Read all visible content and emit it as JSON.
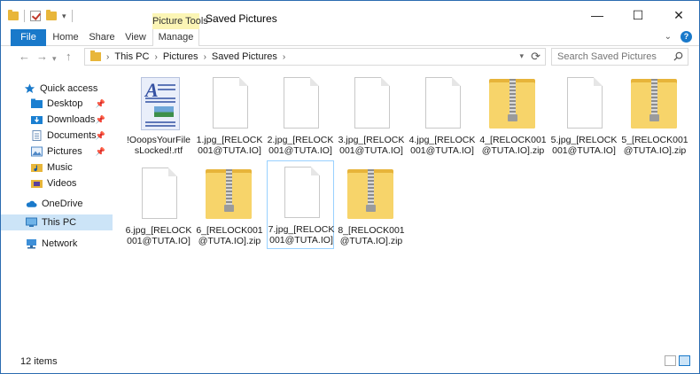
{
  "window": {
    "title": "Saved Pictures",
    "controls": {
      "minimize": "—",
      "maximize": "☐",
      "close": "✕"
    }
  },
  "ribbon": {
    "contextual_header": "Picture Tools",
    "tabs": [
      {
        "label": "File"
      },
      {
        "label": "Home"
      },
      {
        "label": "Share"
      },
      {
        "label": "View"
      },
      {
        "label": "Manage"
      }
    ]
  },
  "address": {
    "breadcrumbs": [
      "This PC",
      "Pictures",
      "Saved Pictures"
    ],
    "search_placeholder": "Search Saved Pictures"
  },
  "nav": {
    "items": [
      {
        "label": "Quick access",
        "icon": "star-icon"
      },
      {
        "label": "Desktop",
        "icon": "desktop-folder-icon",
        "pinned": true
      },
      {
        "label": "Downloads",
        "icon": "downloads-folder-icon",
        "pinned": true
      },
      {
        "label": "Documents",
        "icon": "documents-folder-icon",
        "pinned": true
      },
      {
        "label": "Pictures",
        "icon": "pictures-folder-icon",
        "pinned": true
      },
      {
        "label": "Music",
        "icon": "music-folder-icon"
      },
      {
        "label": "Videos",
        "icon": "videos-folder-icon"
      },
      {
        "label": "OneDrive",
        "icon": "onedrive-cloud-icon"
      },
      {
        "label": "This PC",
        "icon": "computer-icon",
        "selected": true
      },
      {
        "label": "Network",
        "icon": "network-icon"
      }
    ]
  },
  "files": [
    {
      "name": "!OoopsYourFilesLocked!.rtf",
      "type": "rtf"
    },
    {
      "name": "1.jpg_[RELOCK001@TUTA.IO]",
      "type": "blank"
    },
    {
      "name": "2.jpg_[RELOCK001@TUTA.IO]",
      "type": "blank"
    },
    {
      "name": "3.jpg_[RELOCK001@TUTA.IO]",
      "type": "blank"
    },
    {
      "name": "4.jpg_[RELOCK001@TUTA.IO]",
      "type": "blank"
    },
    {
      "name": "4_[RELOCK001@TUTA.IO].zip",
      "type": "zip"
    },
    {
      "name": "5.jpg_[RELOCK001@TUTA.IO]",
      "type": "blank"
    },
    {
      "name": "5_[RELOCK001@TUTA.IO].zip",
      "type": "zip"
    },
    {
      "name": "6.jpg_[RELOCK001@TUTA.IO]",
      "type": "blank"
    },
    {
      "name": "6_[RELOCK001@TUTA.IO].zip",
      "type": "zip"
    },
    {
      "name": "7.jpg_[RELOCK001@TUTA.IO]",
      "type": "blank",
      "focused": true
    },
    {
      "name": "8_[RELOCK001@TUTA.IO].zip",
      "type": "zip"
    }
  ],
  "status": {
    "item_count": "12 items"
  }
}
